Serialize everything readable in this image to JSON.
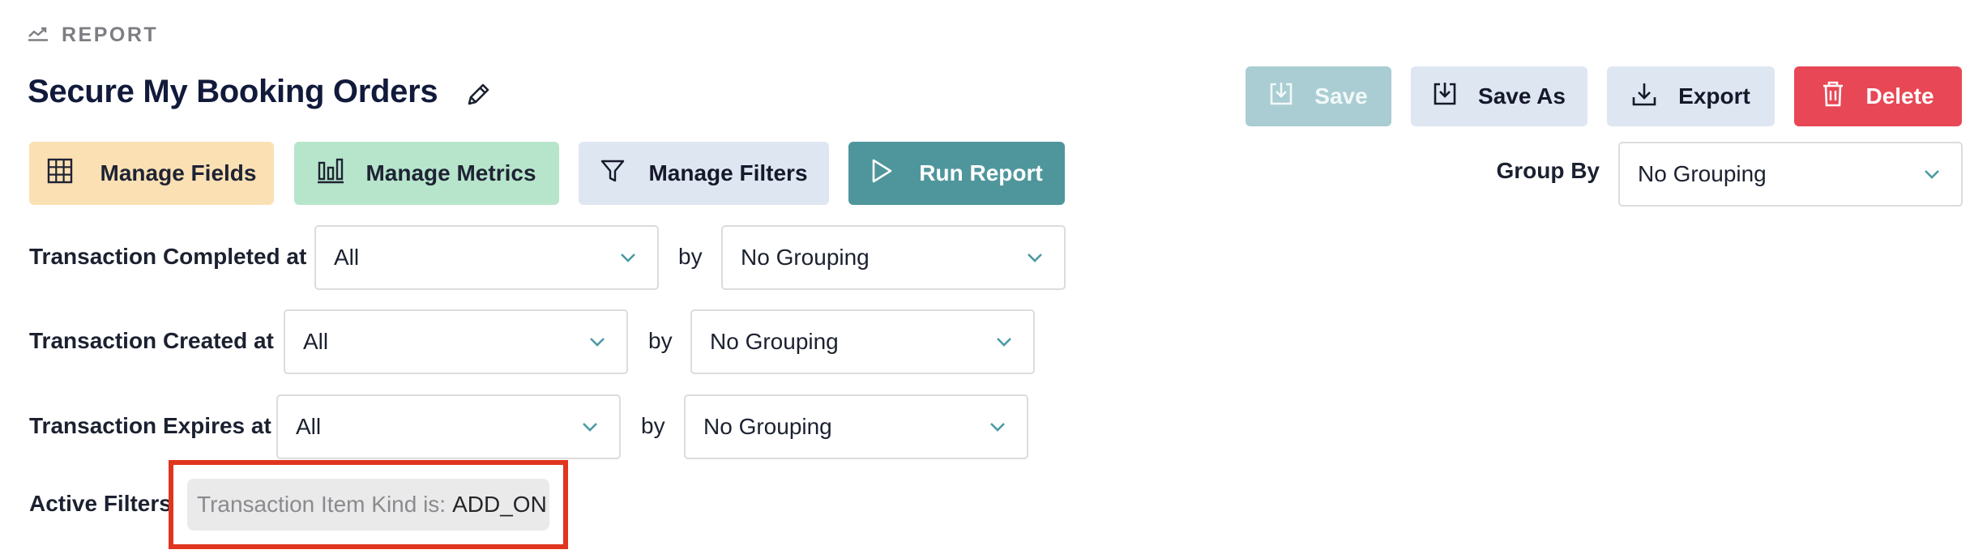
{
  "header": {
    "kicker": "REPORT",
    "title": "Secure My Booking Orders"
  },
  "actions": {
    "save": "Save",
    "save_as": "Save As",
    "export": "Export",
    "delete": "Delete"
  },
  "toolbar": {
    "manage_fields": "Manage Fields",
    "manage_metrics": "Manage Metrics",
    "manage_filters": "Manage Filters",
    "run_report": "Run Report"
  },
  "group_by": {
    "label": "Group By",
    "value": "No Grouping"
  },
  "date_filters": [
    {
      "label": "Transaction Completed at",
      "value": "All",
      "by": "by",
      "grouping": "No Grouping"
    },
    {
      "label": "Transaction Created at",
      "value": "All",
      "by": "by",
      "grouping": "No Grouping"
    },
    {
      "label": "Transaction Expires at",
      "value": "All",
      "by": "by",
      "grouping": "No Grouping"
    }
  ],
  "active_filters": {
    "label": "Active Filters",
    "chips": [
      {
        "key": "Transaction Item Kind is:",
        "value": "ADD_ON"
      }
    ]
  },
  "colors": {
    "save_disabled": "#a9cdd2",
    "secondary": "#dee6f2",
    "delete": "#e84755",
    "fields": "#fbe0b4",
    "metrics": "#b7e5cb",
    "run": "#4f969c",
    "chevron": "#4b9aa4",
    "highlight": "#e0351f"
  },
  "icons": {
    "kicker": "trend-line-icon",
    "edit": "pencil-icon",
    "save": "save-download-icon",
    "save_as": "save-download-icon",
    "export": "download-icon",
    "delete": "trash-icon",
    "fields": "grid-icon",
    "metrics": "bar-chart-icon",
    "filters": "funnel-icon",
    "run": "play-icon",
    "select": "chevron-down-icon"
  }
}
